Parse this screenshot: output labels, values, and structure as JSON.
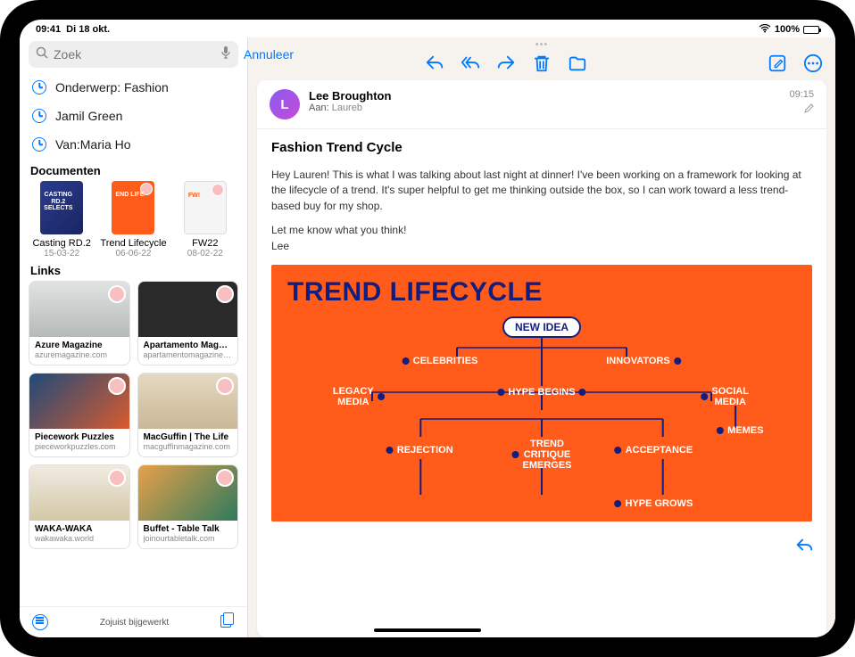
{
  "status": {
    "time": "09:41",
    "date": "Di 18 okt.",
    "battery": "100%"
  },
  "sidebar": {
    "search_placeholder": "Zoek",
    "cancel": "Annuleer",
    "recents": [
      "Onderwerp: Fashion",
      "Jamil Green",
      "Van:Maria Ho"
    ],
    "documents_label": "Documenten",
    "documents": [
      {
        "title": "Casting RD.2",
        "date": "15-03-22",
        "thumb": "blue",
        "thumb_text": "CASTING\nRD.2\nSELECTS"
      },
      {
        "title": "Trend Lifecycle",
        "date": "06-06-22",
        "thumb": "orange",
        "thumb_text": "END LIFE"
      },
      {
        "title": "FW22",
        "date": "08-02-22",
        "thumb": "white",
        "thumb_text": "FW!"
      }
    ],
    "links_label": "Links",
    "links": [
      {
        "title": "Azure Magazine",
        "url": "azuremagazine.com",
        "cls": "azure"
      },
      {
        "title": "Apartamento Magazine",
        "url": "apartamentomagazine.c…",
        "cls": "apart"
      },
      {
        "title": "Piecework Puzzles",
        "url": "pieceworkpuzzles.com",
        "cls": "piece"
      },
      {
        "title": "MacGuffin | The Life",
        "url": "macguffinmagazine.com",
        "cls": "macg"
      },
      {
        "title": "WAKA-WAKA",
        "url": "wakawaka.world",
        "cls": "waka"
      },
      {
        "title": "Buffet - Table Talk",
        "url": "joinourtabletalk.com",
        "cls": "buffet"
      }
    ],
    "updated": "Zojuist bijgewerkt"
  },
  "mail": {
    "sender": "Lee Broughton",
    "to_label": "Aan:",
    "to": "Laureb",
    "time": "09:15",
    "subject": "Fashion Trend Cycle",
    "body_p1": "Hey Lauren! This is what I was talking about last night at dinner! I've been working on a framework for looking at the lifecycle of a trend. It's super helpful to get me thinking outside the box, so I can work toward a less trend-based buy for my shop.",
    "body_p2": "Let me know what you think!",
    "body_sign": "Lee",
    "attachment": {
      "title": "TREND LIFECYCLE",
      "pill": "NEW IDEA",
      "nodes": {
        "celebrities": "CELEBRITIES",
        "innovators": "INNOVATORS",
        "legacy": "LEGACY\nMEDIA",
        "hype_begins": "HYPE BEGINS",
        "social": "SOCIAL\nMEDIA",
        "memes": "MEMES",
        "rejection": "REJECTION",
        "critique": "TREND\nCRITIQUE\nEMERGES",
        "acceptance": "ACCEPTANCE",
        "hype_grows": "HYPE GROWS"
      }
    }
  }
}
